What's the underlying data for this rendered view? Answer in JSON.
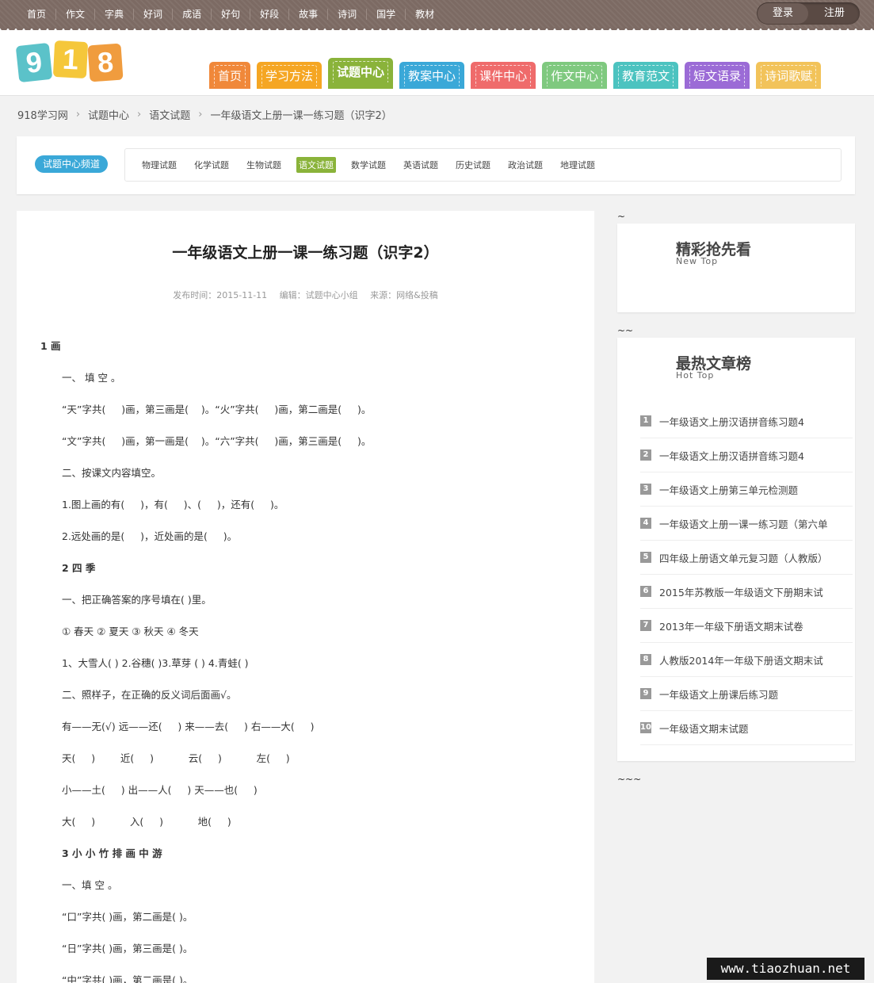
{
  "topnav": [
    "首页",
    "作文",
    "字典",
    "好词",
    "成语",
    "好句",
    "好段",
    "故事",
    "诗词",
    "国学",
    "教材"
  ],
  "auth": {
    "login": "登录",
    "register": "注册"
  },
  "logo": {
    "digits": [
      "9",
      "1",
      "8"
    ],
    "colors": [
      "#5bc2c9",
      "#f5c73a",
      "#f09c3e"
    ]
  },
  "mainnav": [
    {
      "label": "首页",
      "color": "#f0883a"
    },
    {
      "label": "学习方法",
      "color": "#f5a623"
    },
    {
      "label": "试题中心",
      "color": "#8ab33a",
      "active": true
    },
    {
      "label": "教案中心",
      "color": "#3aa8d8"
    },
    {
      "label": "课件中心",
      "color": "#ef6b6b"
    },
    {
      "label": "作文中心",
      "color": "#7fc97f"
    },
    {
      "label": "教育范文",
      "color": "#4cc3c0"
    },
    {
      "label": "短文语录",
      "color": "#9b6bd6"
    },
    {
      "label": "诗词歌赋",
      "color": "#f2c35a"
    }
  ],
  "breadcrumb": [
    "918学习网",
    "试题中心",
    "语文试题",
    "一年级语文上册一课一练习题（识字2）"
  ],
  "channel": {
    "label": "试题中心频道",
    "links": [
      "物理试题",
      "化学试题",
      "生物试题",
      "语文试题",
      "数学试题",
      "英语试题",
      "历史试题",
      "政治试题",
      "地理试题"
    ],
    "active": "语文试题"
  },
  "article": {
    "title": "一年级语文上册一课一练习题（识字2）",
    "date": "发布时间：2015-11-11",
    "editor": "编辑：试题中心小组",
    "source": "来源：网络&投稿",
    "lines": [
      {
        "t": "1 画",
        "h": true
      },
      {
        "t": "一、 填 空 。",
        "ind": true
      },
      {
        "t": "“天”字共(     )画，第三画是(    )。“火”字共(     )画，第二画是(     )。",
        "ind": true
      },
      {
        "t": "“文”字共(     )画，第一画是(    )。“六”字共(     )画，第三画是(     )。",
        "ind": true
      },
      {
        "t": "二、按课文内容填空。",
        "ind": true
      },
      {
        "t": "1.图上画的有(     )，有(     )、(     )，还有(     )。",
        "ind": true
      },
      {
        "t": "2.远处画的是(     )，近处画的是(     )。",
        "ind": true
      },
      {
        "t": "2 四 季",
        "h": true,
        "ind": true
      },
      {
        "t": "一、把正确答案的序号填在( )里。",
        "ind": true
      },
      {
        "t": "① 春天 ② 夏天 ③ 秋天 ④ 冬天",
        "ind": true
      },
      {
        "t": "1、大雪人( ) 2.谷穗( )3.草芽 ( ) 4.青蛙( )",
        "ind": true
      },
      {
        "t": "二、照样子，在正确的反义词后面画√。",
        "ind": true
      },
      {
        "t": "有——无(√) 远——还(     ) 来——去(     ) 右——大(     )",
        "ind": true
      },
      {
        "t": "天(     )        近(     )           云(     )           左(     )",
        "ind": true
      },
      {
        "t": "小——土(     ) 出——人(     ) 天——也(     )",
        "ind": true
      },
      {
        "t": "大(     )           入(     )           地(     )",
        "ind": true
      },
      {
        "t": "3 小 小 竹 排 画 中 游",
        "h": true,
        "ind": true
      },
      {
        "t": "一、填 空 。",
        "ind": true
      },
      {
        "t": "“口”字共( )画，第二画是( )。",
        "ind": true
      },
      {
        "t": "“日”字共( )画，第三画是( )。",
        "ind": true
      },
      {
        "t": "“中”字共( )画，第二画是( )。",
        "ind": true
      }
    ]
  },
  "sidebar": {
    "tilde1": "~",
    "box1": {
      "title": "精彩抢先看",
      "sub": "New  Top"
    },
    "tilde2": "~~",
    "box2": {
      "title": "最热文章榜",
      "sub": "Hot  Top"
    },
    "rank": [
      "一年级语文上册汉语拼音练习题4",
      "一年级语文上册汉语拼音练习题4",
      "一年级语文上册第三单元检测题",
      "一年级语文上册一课一练习题（第六单",
      "四年级上册语文单元复习题（人教版）",
      "2015年苏教版一年级语文下册期末试",
      "2013年一年级下册语文期末试卷",
      "人教版2014年一年级下册语文期末试",
      "一年级语文上册课后练习题",
      "一年级语文期末试题"
    ],
    "tilde3": "~~~"
  },
  "watermark": "www.tiaozhuan.net"
}
